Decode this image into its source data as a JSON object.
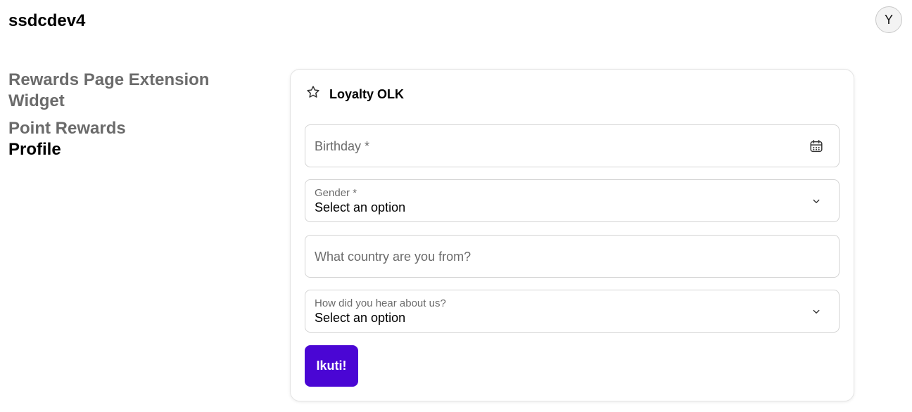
{
  "app": {
    "title": "ssdcdev4",
    "avatar_initial": "Y"
  },
  "nav": {
    "items": [
      {
        "label": "Rewards Page Extension Widget"
      },
      {
        "label": "Point Rewards"
      },
      {
        "label": "Profile",
        "active": true
      }
    ]
  },
  "card": {
    "icon": "star-icon",
    "title": "Loyalty OLK",
    "fields": {
      "birthday": {
        "placeholder": "Birthday *",
        "icon": "calendar-icon"
      },
      "gender": {
        "label": "Gender *",
        "value": "Select an option",
        "icon": "chevron-down-icon"
      },
      "country": {
        "placeholder": "What country are you from?"
      },
      "referral": {
        "label": "How did you hear about us?",
        "value": "Select an option",
        "icon": "chevron-down-icon"
      }
    },
    "submit_label": "Ikuti!"
  },
  "colors": {
    "primary": "#4a06d4",
    "muted_text": "#6b6b6b",
    "border": "#d4d4d4"
  }
}
